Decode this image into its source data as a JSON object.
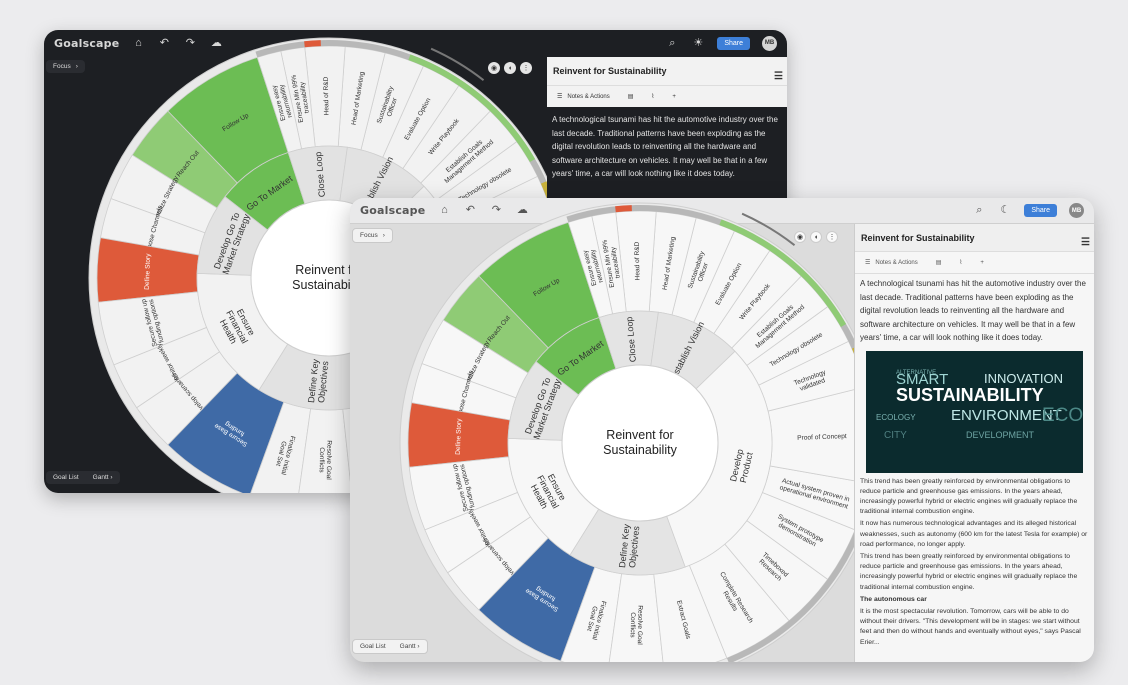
{
  "app": {
    "logo": "Goalscape",
    "share_label": "Share",
    "avatar_initials": "MB"
  },
  "toolbar": {
    "home_icon": "home-icon",
    "undo_icon": "undo-icon",
    "redo_icon": "redo-icon",
    "cloud_icon": "cloud-icon",
    "search_icon": "search-icon",
    "dark_theme_icon": "sun-icon",
    "light_theme_icon": "moon-icon"
  },
  "focus_label": "Focus",
  "footer": {
    "goal_list": "Goal List",
    "gantt": "Gantt"
  },
  "wheel": {
    "center": [
      "Reinvent for",
      "Sustainability"
    ],
    "ring1": {
      "close_loop": "Close Loop",
      "establish_vision": "Establish Vision",
      "develop_product": [
        "Develop",
        "Product"
      ],
      "define_objectives": [
        "Define Key",
        "Objectives"
      ],
      "ensure_health": [
        "Ensure",
        "Financial",
        "Health"
      ],
      "develop_gtm": [
        "Develop Go To",
        "Market Strategy"
      ],
      "go_to_market": "Go To Market"
    },
    "ring2": {
      "follow_up": "Follow Up",
      "reach_out": "Reach Out",
      "finalize_strategy": "Finalize Strategy",
      "choose_channels": "Choose Channels",
      "define_story": "Define Story",
      "secure_followup": [
        "Secure follow up",
        "funding options"
      ],
      "monitor_weekly": "Monitor weekly",
      "develop_scenarios": "Develop scenarios",
      "secure_base": [
        "Secure Base",
        "funding"
      ],
      "finalize_initial": [
        "Finalize Initial",
        "Goal Set"
      ],
      "resolve_conflicts": [
        "Resolve Goal",
        "Conflicts"
      ],
      "extract_goals": "Extract Goals",
      "complete_research": [
        "Complete Research",
        "Results"
      ],
      "timeboxed_research": [
        "Timeboxed",
        "Research"
      ],
      "proof_of_concept": "Proof of Concept",
      "technology_validated": [
        "Technology",
        "validated"
      ],
      "write_playbook": "Write Playbook",
      "evaluate_option": "Evaluate Option",
      "sustainability_officer": [
        "Sustainability",
        "Officer"
      ],
      "head_of_marketing": "Head of Marketing",
      "head_of_rd": "Head of R&D",
      "ensure_min": [
        "Ensure Min 99%",
        "traceability"
      ],
      "ensure_easy": [
        "Ensure easy",
        "returnability"
      ],
      "establish_goals": [
        "Establish Goals",
        "Management Method"
      ],
      "technology_obsolete": "Technology obsolete",
      "actual_system": [
        "Actual system proven in",
        "operational environment"
      ],
      "system_prototype": [
        "System prototype",
        "demonstration"
      ]
    }
  },
  "panel": {
    "title": "Reinvent for Sustainability",
    "tab_notes": "Notes & Actions",
    "intro": "A technological tsunami has hit the automotive industry over the last decade. Traditional patterns have been exploding as the digital revolution leads to reinventing all the hardware and software architecture on vehicles. It may well be that in a few years' time, a car will look nothing like it does today.",
    "para1": "This trend has been greatly reinforced by environmental obligations to reduce particle and greenhouse gas emissions. In the years ahead, increasingly powerful hybrid or electric engines will gradually replace the traditional internal combustion engine.",
    "para2": "It now has numerous technological advantages and its alleged historical weaknesses, such as autonomy (600 km for the latest Tesla for example) or road performance, no longer apply.",
    "para3": "This trend has been greatly reinforced by environmental obligations to reduce particle and greenhouse gas emissions. In the years ahead, increasingly powerful hybrid or electric engines will gradually replace the traditional internal combustion engine.",
    "heading": "The autonomous car",
    "para4": "It is the most spectacular revolution. Tomorrow, cars will be able to do without their drivers. \"This development will be in stages: we start without feet and then do without hands and eventually without eyes,\" says Pascal Erier..."
  },
  "wordcloud": {
    "sustainability": "SUSTAINABILITY",
    "environment": "ENVIRONMENT",
    "smart": "SMART",
    "innovation": "INNOVATION",
    "alternative": "ALTERNATIVE",
    "ecology": "ECOLOGY",
    "development": "DEVELOPMENT",
    "eco": "ECO",
    "city": "CITY"
  },
  "colors": {
    "green": "#6cbd54",
    "green_light": "#8fcb75",
    "red": "#de5a3a",
    "blue": "#3f6aa6",
    "accent_blue": "#3d7fd8"
  }
}
